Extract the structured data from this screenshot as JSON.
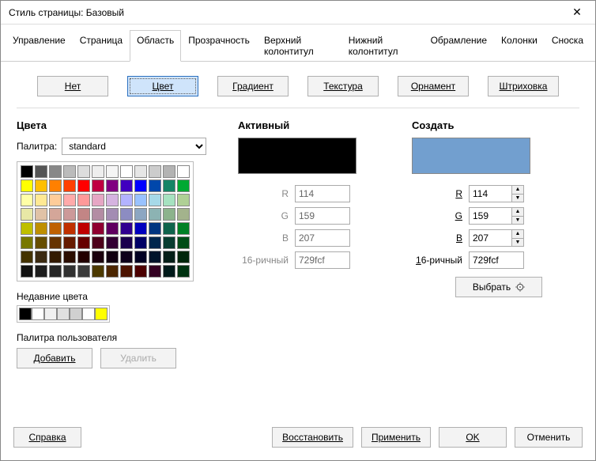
{
  "title": "Стиль страницы: Базовый",
  "tabs": [
    "Управление",
    "Страница",
    "Область",
    "Прозрачность",
    "Верхний колонтитул",
    "Нижний колонтитул",
    "Обрамление",
    "Колонки",
    "Сноска"
  ],
  "active_tab": 2,
  "fill": {
    "none": "Нет",
    "color": "Цвет",
    "gradient": "Градиент",
    "texture": "Текстура",
    "pattern": "Орнамент",
    "hatch": "Штриховка"
  },
  "colors": {
    "heading": "Цвета",
    "palette_label": "Палитра:",
    "palette_value": "standard",
    "recent_label": "Недавние цвета",
    "custom_label": "Палитра пользователя",
    "add_btn": "Добавить",
    "delete_btn": "Удалить",
    "swatches": [
      "#000000",
      "#555555",
      "#888888",
      "#bbbbbb",
      "#dddddd",
      "#eeeeee",
      "#f5f5f5",
      "#ffffff",
      "#e6e6e6",
      "#cccccc",
      "#b3b3b3",
      "#ffffff",
      "#ffff00",
      "#ffbf00",
      "#ff8000",
      "#ff4000",
      "#ff0000",
      "#bf0041",
      "#800080",
      "#4000bf",
      "#0000ff",
      "#0047ab",
      "#158466",
      "#00a933",
      "#ffffa6",
      "#ffe994",
      "#ffcc99",
      "#ffaaaa",
      "#ff9999",
      "#e6a6c4",
      "#d5b3e0",
      "#b3b3ff",
      "#99c2ff",
      "#a6d9e8",
      "#a6e2c0",
      "#afd095",
      "#e8e8a6",
      "#e0c2a6",
      "#d4a699",
      "#cc9999",
      "#c28585",
      "#b38ca3",
      "#a38cb3",
      "#8c8cc2",
      "#8ca6c2",
      "#8cb3b3",
      "#8cb38c",
      "#a3b38c",
      "#bfbf00",
      "#bf8f00",
      "#bf6000",
      "#bf3000",
      "#bf0000",
      "#8f0030",
      "#600060",
      "#30008f",
      "#0000bf",
      "#003580",
      "#0f634c",
      "#008026",
      "#777700",
      "#664d00",
      "#663300",
      "#661a00",
      "#660000",
      "#4d001a",
      "#330033",
      "#1a004d",
      "#000066",
      "#00264d",
      "#083d30",
      "#004d17",
      "#443300",
      "#3b2a11",
      "#331a00",
      "#2a0d00",
      "#220000",
      "#1a000d",
      "#110011",
      "#0d001a",
      "#000022",
      "#00132a",
      "#041f18",
      "#00260b",
      "#111111",
      "#1c1c1c",
      "#262626",
      "#303030",
      "#3b3b3b",
      "#4c3900",
      "#4c2600",
      "#4c1300",
      "#4c0000",
      "#330022",
      "#001a1a",
      "#003311"
    ],
    "recent": [
      "#000000",
      "#ffffff",
      "#f0f0f0",
      "#e0e0e0",
      "#d0d0d0",
      "#ffffff",
      "#ffff00"
    ]
  },
  "active": {
    "heading": "Активный",
    "color": "#000000",
    "r_label": "R",
    "r_val": "114",
    "g_label": "G",
    "g_val": "159",
    "b_label": "B",
    "b_val": "207",
    "hex_label": "16-ричный",
    "hex_val": "729fcf"
  },
  "new": {
    "heading": "Создать",
    "color": "#729fcf",
    "r_label": "R",
    "r_val": "114",
    "g_label": "G",
    "g_val": "159",
    "b_label": "B",
    "b_val": "207",
    "hex_label": "16-ричный",
    "hex_val": "729fcf",
    "pick_btn": "Выбрать"
  },
  "dlg": {
    "help": "Справка",
    "reset": "Восстановить",
    "apply": "Применить",
    "ok": "OK",
    "cancel": "Отменить"
  }
}
